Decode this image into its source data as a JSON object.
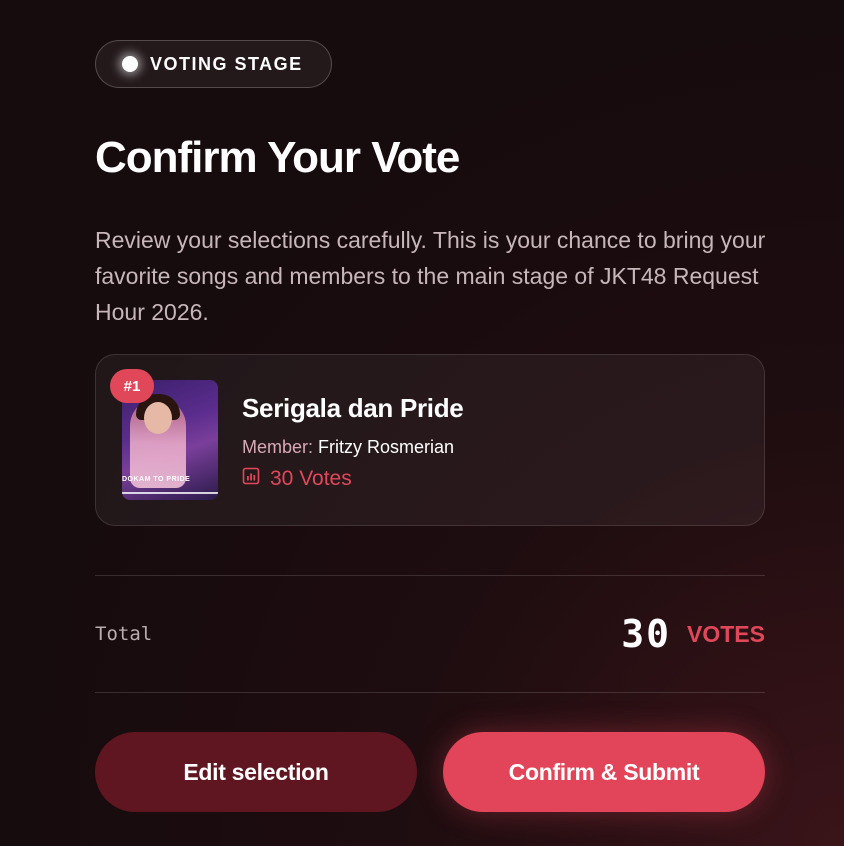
{
  "badge": {
    "label": "VOTING STAGE"
  },
  "title": "Confirm Your Vote",
  "description": "Review your selections carefully. This is your chance to bring your favorite songs and members to the main stage of JKT48 Request Hour 2026.",
  "selection": {
    "rank": "#1",
    "song": "Serigala dan Pride",
    "member_label": "Member:",
    "member_name": "Fritzy Rosmerian",
    "votes": "30 Votes",
    "thumbnail_caption": "DOKAM TO PRIDE"
  },
  "total": {
    "label": "Total",
    "value": "30",
    "unit": "VOTES"
  },
  "actions": {
    "edit_label": "Edit selection",
    "confirm_label": "Confirm & Submit"
  },
  "colors": {
    "accent": "#e0485a",
    "edit_bg": "#5f1621",
    "confirm_bg": "#e24459"
  }
}
